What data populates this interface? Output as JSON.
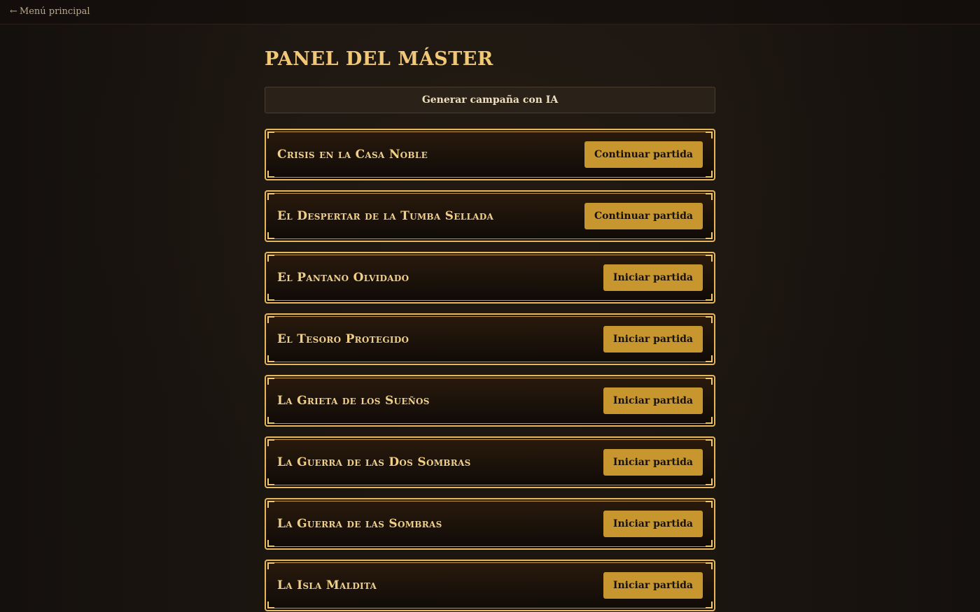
{
  "nav": {
    "back_arrow": "←",
    "back_label": "Menú principal"
  },
  "page": {
    "title": "PANEL DEL MÁSTER",
    "generate_label": "Generar campaña con IA"
  },
  "campaigns": [
    {
      "title": "Crisis en la Casa Noble",
      "action": "Continuar partida"
    },
    {
      "title": "El Despertar de la Tumba Sellada",
      "action": "Continuar partida"
    },
    {
      "title": "El Pantano Olvidado",
      "action": "Iniciar partida"
    },
    {
      "title": "El Tesoro Protegido",
      "action": "Iniciar partida"
    },
    {
      "title": "La Grieta de los Sueños",
      "action": "Iniciar partida"
    },
    {
      "title": "La Guerra de las Dos Sombras",
      "action": "Iniciar partida"
    },
    {
      "title": "La Guerra de las Sombras",
      "action": "Iniciar partida"
    },
    {
      "title": "La Isla Maldita",
      "action": "Iniciar partida"
    }
  ],
  "colors": {
    "accent_gold": "#e8b858",
    "button_gold": "#c8962e",
    "background": "#1a1410"
  }
}
